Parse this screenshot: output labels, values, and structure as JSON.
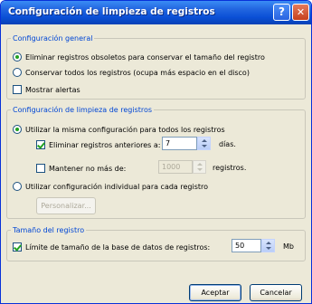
{
  "window": {
    "title": "Configuración de limpieza de registros",
    "help_label": "?",
    "close_label": "✕"
  },
  "general": {
    "legend": "Configuración general",
    "option_remove": "Eliminar registros obsoletos para conservar el tamaño del registro",
    "option_keep": "Conservar todos los registros (ocupa más espacio en el disco)",
    "show_alerts": "Mostrar alertas"
  },
  "cleanup": {
    "legend": "Configuración de limpieza de registros",
    "option_same": "Utilizar la misma configuración para todos los registros",
    "delete_before_label": "Eliminar registros anteriores a:",
    "delete_before_value": "7",
    "days_label": "días.",
    "keep_max_label": "Mantener no más de:",
    "keep_max_value": "1000",
    "records_label": "registros.",
    "option_individual": "Utilizar configuración individual para cada registro",
    "customize_button": "Personalizar..."
  },
  "size": {
    "legend": "Tamaño del registro",
    "limit_label": "Límite de tamaño de la base de datos de registros:",
    "limit_value": "50",
    "unit": "Mb"
  },
  "buttons": {
    "accept": "Aceptar",
    "cancel": "Cancelar"
  }
}
